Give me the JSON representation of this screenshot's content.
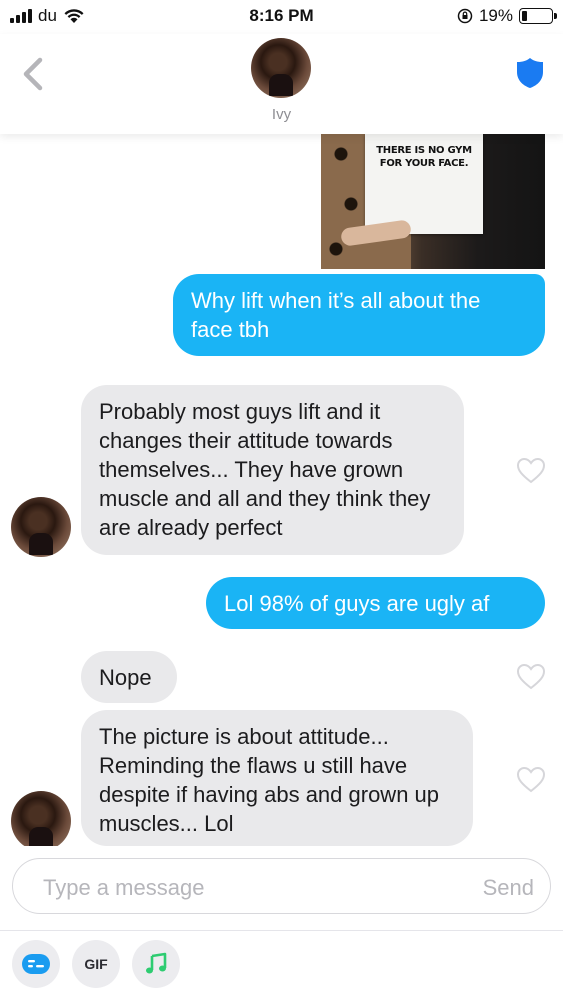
{
  "status_bar": {
    "carrier": "du",
    "time": "8:16 PM",
    "battery_percent": "19%",
    "battery_level": 0.19,
    "icons": [
      "signal-icon",
      "wifi-icon",
      "rotation-lock-icon",
      "battery-icon"
    ]
  },
  "header": {
    "back_icon": "chevron-left-icon",
    "contact_name": "Ivy",
    "safety_icon": "shield-icon",
    "accent_color": "#1a7bf2"
  },
  "messages": [
    {
      "direction": "out",
      "type": "image",
      "sign_text": "THERE IS NO GYM FOR YOUR FACE."
    },
    {
      "direction": "out",
      "type": "text",
      "text": "Why lift when it’s all about the face tbh"
    },
    {
      "direction": "in",
      "type": "text",
      "text": "Probably most guys lift and it changes their attitude towards themselves... They have grown muscle and all and they think they are already perfect"
    },
    {
      "direction": "out",
      "type": "text",
      "text": "Lol 98% of guys are ugly af"
    },
    {
      "direction": "in",
      "type": "text",
      "text": "Nope"
    },
    {
      "direction": "in",
      "type": "text",
      "text": "The picture is about attitude... Reminding the flaws u still have despite if having abs and grown up muscles... Lol"
    }
  ],
  "composer": {
    "placeholder": "Type a message",
    "send_label": "Send"
  },
  "toolbar": {
    "gif_label": "GIF",
    "icons": [
      "sticker-icon",
      "gif-icon",
      "music-icon"
    ],
    "music_color": "#2ecc71",
    "sticker_color": "#1a9cf0"
  },
  "colors": {
    "outgoing_bubble": "#1ab4f5",
    "incoming_bubble": "#e9e9eb"
  }
}
